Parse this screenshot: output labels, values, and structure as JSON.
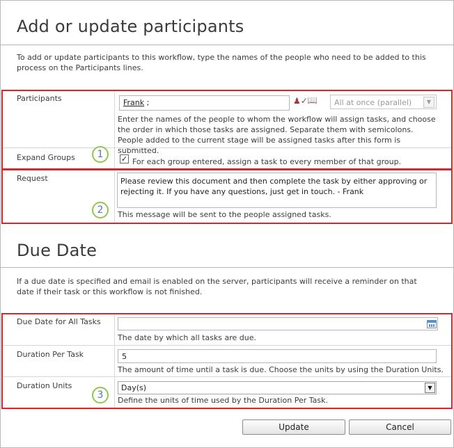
{
  "section1": {
    "title": "Add or update participants",
    "description": "To add or update participants to this workflow, type the names of the people who need to be added to this process on the Participants lines."
  },
  "participants": {
    "label": "Participants",
    "value_name": "Frank",
    "value_suffix": " ;",
    "order_select": "All at once (parallel)",
    "help": "Enter the names of the people to whom the workflow will assign tasks, and choose the order in which those tasks are assigned. Separate them with semicolons. People added to the current stage will be assigned tasks after this form is submitted."
  },
  "expand_groups": {
    "label": "Expand Groups",
    "checkbox_text": "For each group entered, assign a task to every member of that group.",
    "checked": true
  },
  "request": {
    "label": "Request",
    "value": "Please review this document and then complete the task by either approving or rejecting it. If you have any questions, just get in touch. - Frank",
    "help": "This message will be sent to the people assigned tasks."
  },
  "section2": {
    "title": "Due Date",
    "description": "If a due date is specified and email is enabled on the server, participants will receive a reminder on that date if their task or this workflow is not finished."
  },
  "due_date": {
    "label": "Due Date for All Tasks",
    "value": "",
    "help": "The date by which all tasks are due."
  },
  "duration": {
    "label": "Duration Per Task",
    "value": "5",
    "help": "The amount of time until a task is due. Choose the units by using the Duration Units."
  },
  "duration_units": {
    "label": "Duration Units",
    "value": "Day(s)",
    "help": "Define the units of time used by the Duration Per Task."
  },
  "callouts": [
    "1",
    "2",
    "3"
  ],
  "buttons": {
    "update": "Update",
    "cancel": "Cancel"
  },
  "colors": {
    "highlight_border": "#d8262f",
    "callout_ring": "#8fc74a",
    "callout_text": "#4f79b5"
  }
}
